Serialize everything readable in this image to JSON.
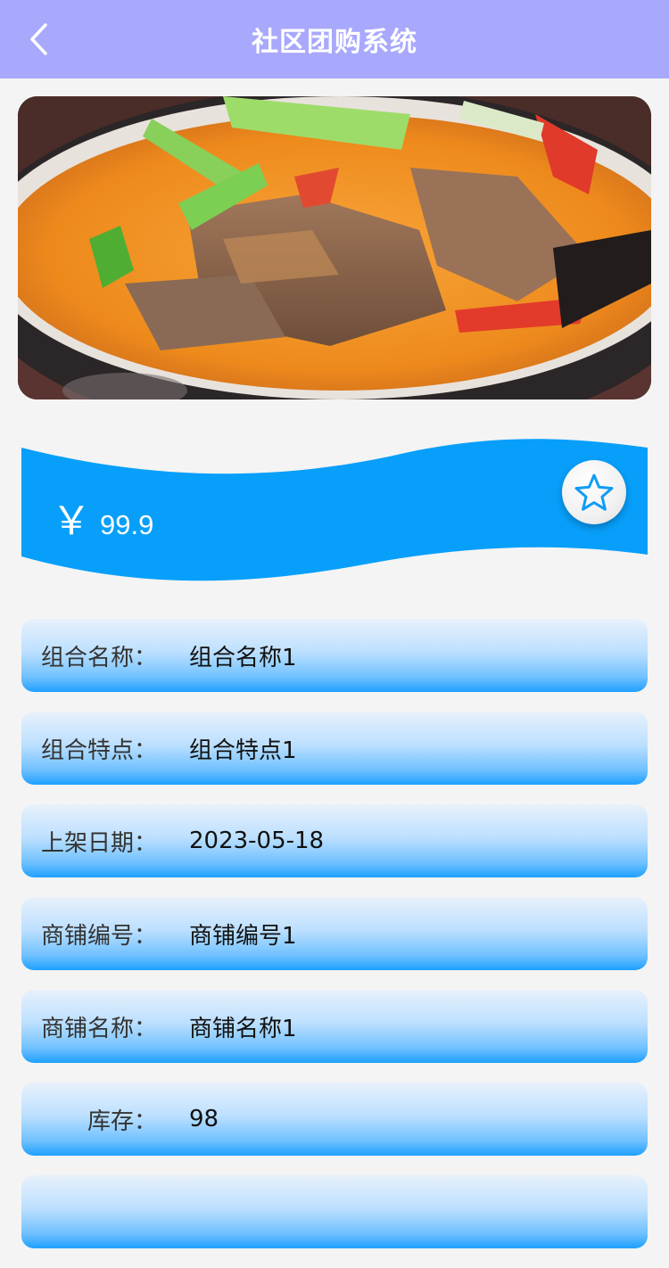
{
  "header": {
    "title": "社区团购系统",
    "back_icon": "chevron-left-icon"
  },
  "product": {
    "image_alt": "fish-dish-photo",
    "price_symbol": "￥",
    "price": "99.9",
    "favorite_icon": "star-outline-icon"
  },
  "colors": {
    "nav_bg": "#a8a8fd",
    "accent": "#079ffa",
    "page_bg": "#f4f4f4"
  },
  "details": [
    {
      "label": "组合名称：",
      "value": "组合名称1"
    },
    {
      "label": "组合特点：",
      "value": "组合特点1"
    },
    {
      "label": "上架日期：",
      "value": "2023-05-18"
    },
    {
      "label": "商铺编号：",
      "value": "商铺编号1"
    },
    {
      "label": "商铺名称：",
      "value": "商铺名称1"
    },
    {
      "label": "库存：",
      "value": "98"
    },
    {
      "label": "",
      "value": ""
    }
  ]
}
